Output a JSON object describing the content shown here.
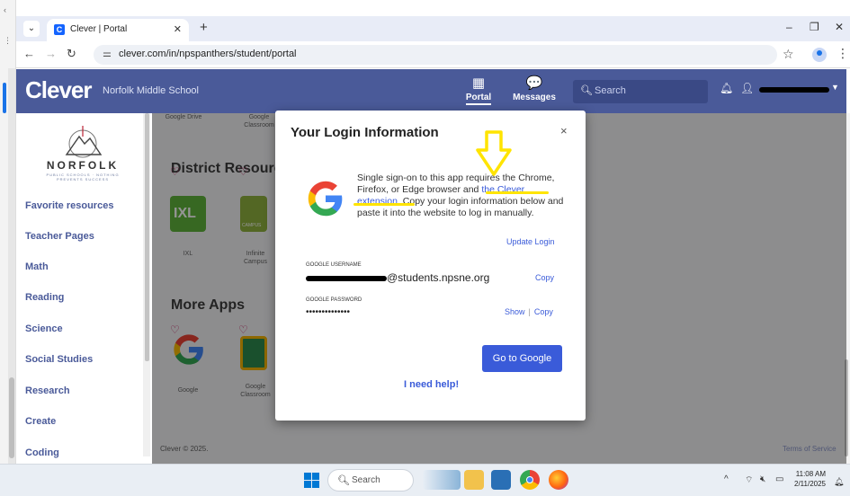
{
  "browser": {
    "tab_title": "Clever | Portal",
    "tab_favicon": "C",
    "new_tab": "+",
    "url": "clever.com/in/npspanthers/student/portal",
    "win_min": "–",
    "win_restore": "❐",
    "win_close": "✕"
  },
  "header": {
    "logo": "Clever",
    "school": "Norfolk Middle School",
    "nav_portal": "Portal",
    "nav_messages": "Messages",
    "search_placeholder": "Search",
    "accent": "#4a5a99"
  },
  "sidebar": {
    "logo_name": "NORFOLK",
    "logo_tagline": "PUBLIC SCHOOLS · NOTHING PREVENTS SUCCESS",
    "items": [
      "Favorite resources",
      "Teacher Pages",
      "Math",
      "Reading",
      "Science",
      "Social Studies",
      "Research",
      "Create",
      "Coding"
    ]
  },
  "content": {
    "top_apps": [
      "Google Drive",
      "Google Classroom"
    ],
    "section_district": "District Resources",
    "district_apps": [
      "IXL",
      "Infinite Campus"
    ],
    "ixl_text": "IXL",
    "campus_text": "CAMPUS",
    "section_more": "More Apps",
    "more_apps": [
      "Google",
      "Google Classroom"
    ],
    "footer": "Clever © 2025.",
    "terms": "Terms of Service"
  },
  "modal": {
    "title": "Your Login Information",
    "close": "×",
    "sso_text_1": "Single sign-on to this app requires the Chrome, Firefox, or Edge browser and ",
    "sso_link": "the Clever extension.",
    "sso_text_2": " Copy your login information below and paste it into the website to log in manually.",
    "update_login": "Update Login",
    "username_label": "GOOGLE USERNAME",
    "username_suffix": "@students.npsne.org",
    "copy": "Copy",
    "password_label": "GOOGLE PASSWORD",
    "password_mask": "••••••••••••••",
    "show": "Show",
    "copy2": "Copy",
    "go_button": "Go to Google",
    "need_help": "I need help!"
  },
  "taskbar": {
    "search_placeholder": "Search",
    "time": "11:08 AM",
    "date": "2/11/2025"
  }
}
